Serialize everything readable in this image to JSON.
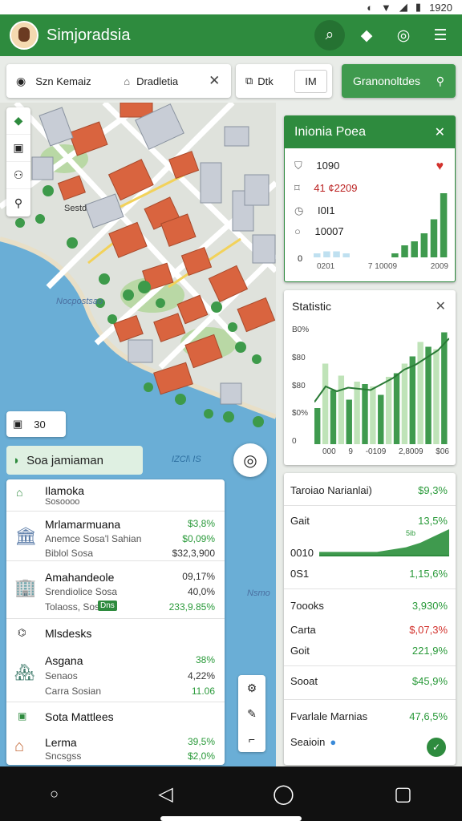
{
  "status_bar": {
    "time": "1920"
  },
  "app": {
    "title": "Simjoradsia"
  },
  "top_icons": [
    "search-icon",
    "layers-icon",
    "chat-icon",
    "menu-icon"
  ],
  "search": {
    "field1": "Szn Kemaiz",
    "field2": "Dradletia",
    "filter_label": "Dtk",
    "filter2_label": "IM"
  },
  "green_chip": {
    "label": "Granonoltdes"
  },
  "map": {
    "label_road": "Sestd",
    "label_water1": "Nocpostsao",
    "label_water2": "Nsmo",
    "zoom_value": "30",
    "colors": {
      "water": "#6aaed6",
      "land": "#dfe2dc",
      "park": "#b9d8a5",
      "roof": "#d9643f",
      "road": "#ffffff",
      "accent": "#2e8b3e"
    }
  },
  "list_header": {
    "title": "Soa jamiaman",
    "meta": "IZCl\\ IS"
  },
  "list": [
    {
      "title": "Ilamoka",
      "subtitle": "Sosoooo",
      "icon": "park-icon",
      "lines": []
    },
    {
      "title": "Mrlamarmuana",
      "subtitle": "Anemce Sosa'l Sahian",
      "sub2": "Biblol Sosa",
      "icon": "museum-icon",
      "values": [
        "$3,8%",
        "$0,09%",
        "$32,3,900"
      ],
      "colors": [
        "g",
        "g",
        "k"
      ]
    },
    {
      "title": "Amahandeole",
      "subtitle": "Srendiolice Sosa",
      "sub2": "Tolaoss, Sos",
      "badge": "Dns",
      "icon": "tower-icon",
      "values": [
        "09,17%",
        "40,0%",
        "233,9.85%"
      ],
      "colors": [
        "k",
        "k",
        "g"
      ]
    },
    {
      "title": "Mlsdesks",
      "icon": "desk-icon"
    },
    {
      "title": "Asgana",
      "subtitle": "Senaos",
      "sub2": "Carra Sosian",
      "icon": "building-icon",
      "values": [
        "38%",
        "4,22%",
        "11.06"
      ],
      "colors": [
        "g",
        "k",
        "g"
      ]
    },
    {
      "title": "Sota Mattlees",
      "icon": "flag-icon"
    },
    {
      "title": "Lerma",
      "subtitle": "Sncsgss",
      "icon": "house-icon",
      "values": [
        "39,5%",
        "$2,0%"
      ],
      "colors": [
        "g",
        "g"
      ]
    }
  ],
  "card1": {
    "title": "Inionia Poea",
    "rows": [
      {
        "icon": "shield-icon",
        "value": "1090"
      },
      {
        "icon": "tag-icon",
        "value": "41 ¢2209"
      },
      {
        "icon": "clock-icon",
        "value": "I0I1"
      },
      {
        "icon": "info-icon",
        "value": "10007"
      }
    ],
    "axis_left": "0",
    "axis_labels": [
      "0201",
      "7 10009",
      "2009"
    ],
    "chart_data": {
      "type": "bar",
      "values": [
        2,
        3,
        3,
        2,
        0,
        0,
        0,
        0,
        2,
        6,
        8,
        12,
        19,
        32
      ]
    }
  },
  "card2": {
    "title": "Statistic",
    "yticks": [
      "B0%",
      "$80",
      "$80",
      "$0%",
      "0"
    ],
    "xticks": [
      "000",
      "9",
      "-0109",
      "2,8009",
      "$06"
    ],
    "chart_data": {
      "type": "bar",
      "ylim": [
        0,
        100
      ],
      "values": [
        30,
        67,
        45,
        57,
        37,
        52,
        50,
        48,
        41,
        56,
        59,
        67,
        73,
        85,
        81,
        79,
        93
      ],
      "line": [
        35,
        48,
        44,
        47,
        46,
        45,
        50,
        55,
        62,
        66,
        72,
        78,
        88
      ]
    }
  },
  "card3": {
    "rows": [
      {
        "label": "Taroiao Narianlai)",
        "value": "$9,3%",
        "color": "g"
      },
      {
        "label": "Gait",
        "value": "13,5%",
        "color": "g"
      },
      {
        "label": "0010",
        "value": "",
        "color": "g"
      },
      {
        "label": "0S1",
        "value": "1,15,6%",
        "color": "g"
      },
      {
        "label": "7oooks",
        "value": "3,930%",
        "color": "g"
      },
      {
        "label": "Carta",
        "value": "$,07,3%",
        "color": "r"
      },
      {
        "label": "Goit",
        "value": "221,9%",
        "color": "g"
      },
      {
        "label": "Sooat",
        "value": "$45,9%",
        "color": "g"
      },
      {
        "label": "Fvarlale Marnias",
        "value": "47,6,5%",
        "color": "g"
      },
      {
        "label": "Seaioin",
        "value": "",
        "color": "g"
      }
    ],
    "spark_label": "5ib",
    "spark": {
      "type": "area",
      "values": [
        2,
        2,
        2,
        2,
        2,
        3,
        4,
        6,
        9,
        12
      ]
    }
  }
}
